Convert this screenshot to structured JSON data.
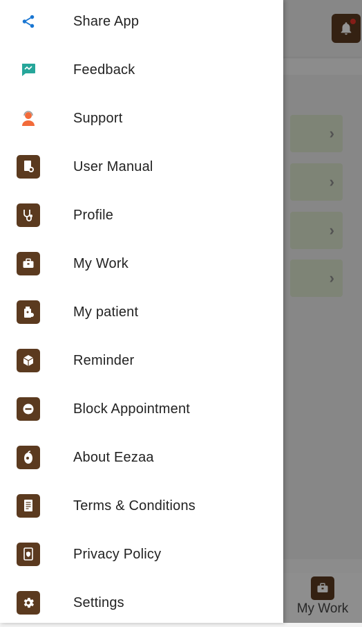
{
  "drawer": {
    "items": [
      {
        "label": "Share App",
        "icon": "share-icon"
      },
      {
        "label": "Feedback",
        "icon": "feedback-icon"
      },
      {
        "label": "Support",
        "icon": "support-icon"
      },
      {
        "label": "User Manual",
        "icon": "user-manual-icon"
      },
      {
        "label": "Profile",
        "icon": "stethoscope-icon"
      },
      {
        "label": "My Work",
        "icon": "briefcase-icon"
      },
      {
        "label": "My patient",
        "icon": "patient-icon"
      },
      {
        "label": "Reminder",
        "icon": "reminder-icon"
      },
      {
        "label": "Block Appointment",
        "icon": "block-icon"
      },
      {
        "label": "About Eezaa",
        "icon": "about-icon"
      },
      {
        "label": "Terms & Conditions",
        "icon": "document-icon"
      },
      {
        "label": "Privacy Policy",
        "icon": "privacy-icon"
      },
      {
        "label": "Settings",
        "icon": "gear-icon"
      }
    ]
  },
  "bottom_nav": {
    "my_work_label": "My Work"
  },
  "colors": {
    "brand_brown": "#5b3a1f",
    "share_blue": "#1976d2",
    "feedback_teal": "#26a69a",
    "support_orange": "#f26b3a"
  }
}
